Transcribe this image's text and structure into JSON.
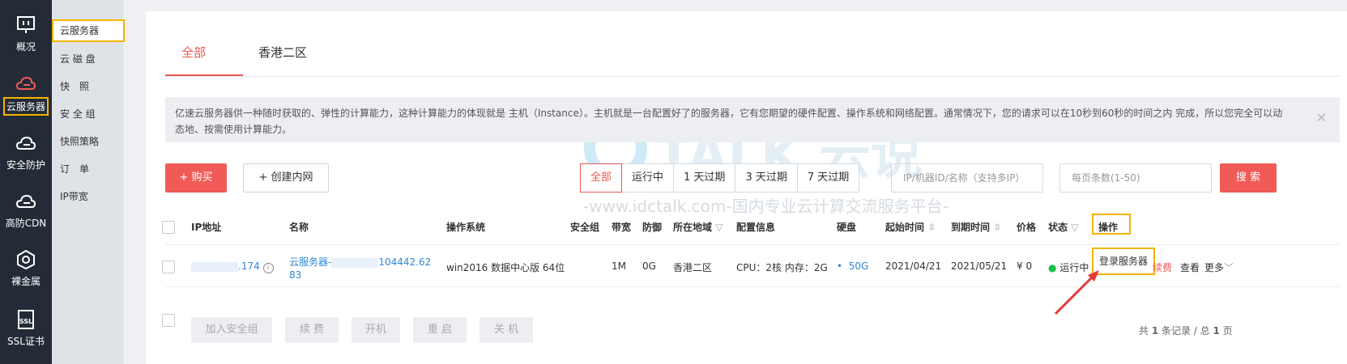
{
  "rail": {
    "items": [
      {
        "label": "概况",
        "icon": "monitor-icon"
      },
      {
        "label": "云服务器",
        "icon": "cloud-server-icon"
      },
      {
        "label": "安全防护",
        "icon": "cloud-shield-icon"
      },
      {
        "label": "高防CDN",
        "icon": "cloud-cdn-icon"
      },
      {
        "label": "裸金属",
        "icon": "bare-metal-icon"
      },
      {
        "label": "SSL证书",
        "icon": "ssl-icon"
      }
    ]
  },
  "subnav": {
    "items": [
      "云服务器",
      "云 磁 盘",
      "快　照",
      "安 全 组",
      "快照策略",
      "订　单",
      "IP带宽"
    ]
  },
  "tabs": [
    "全部",
    "香港二区"
  ],
  "notice": {
    "text": "亿速云服务器供一种随时获取的、弹性的计算能力，这种计算能力的体现就是 主机（Instance）。主机就是一台配置好了的服务器，它有您期望的硬件配置、操作系统和网络配置。通常情况下，您的请求可以在10秒到60秒的时间之内 完成，所以您完全可以动态地、按需使用计算能力。",
    "close": "✕"
  },
  "toolbar": {
    "buy": "+ 购买",
    "create_vpc": "+ 创建内网",
    "filters": [
      "全部",
      "运行中",
      "1 天过期",
      "3 天过期",
      "7 天过期"
    ],
    "ip_placeholder": "IP/机器ID/名称（支持多IP）",
    "page_size_placeholder": "每页条数(1-50)",
    "search": "搜 索"
  },
  "table": {
    "headers": [
      "IP地址",
      "名称",
      "操作系统",
      "安全组",
      "带宽",
      "防御",
      "所在地域",
      "配置信息",
      "硬盘",
      "起始时间",
      "到期时间",
      "价格",
      "状态",
      "操作"
    ],
    "row": {
      "ip_suffix": ".174",
      "name_prefix": "云服务器-",
      "name_suffix": "104442.62",
      "name_line2": "83",
      "os": "win2016 数据中心版 64位",
      "security_group": "",
      "bandwidth": "1M",
      "defense": "0G",
      "region": "香港二区",
      "config": "CPU：2核 内存：2G",
      "disk": "50G",
      "start": "2021/04/21",
      "expire": "2021/05/21",
      "price": "¥ 0",
      "status": "运行中",
      "status_color": "#1bbf49",
      "actions": {
        "login": "登录服务器",
        "renew": "续费",
        "view": "查看",
        "more": "更多"
      }
    }
  },
  "bulk_actions": [
    "加入安全组",
    "续 费",
    "开机",
    "重 启",
    "关 机"
  ],
  "pagination": {
    "prefix": "共 ",
    "records": "1",
    "mid": " 条记录 / 总 ",
    "pages": "1",
    "suffix": " 页"
  },
  "watermark": {
    "brand": "TALK 云说",
    "url": "-www.idctalk.com-国内专业云计算交流服务平台-"
  },
  "colors": {
    "accent": "#e75a55",
    "highlight": "#f5b400",
    "link": "#2f87d6",
    "rail_bg": "#222b36"
  }
}
